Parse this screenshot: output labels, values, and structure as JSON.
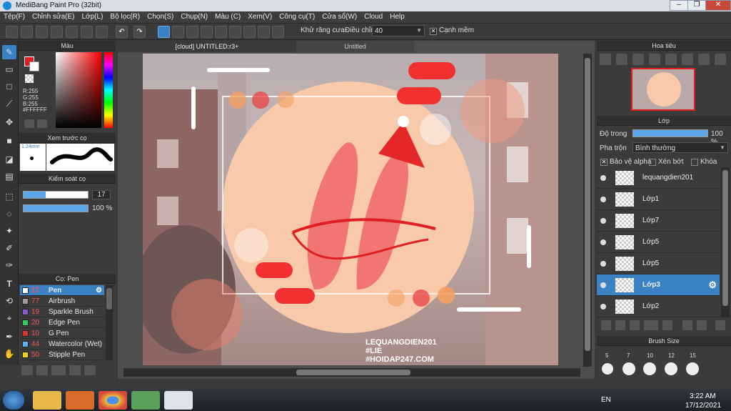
{
  "title": "MediBang Paint Pro (32bit)",
  "menu": [
    "Tệp(F)",
    "Chỉnh sửa(E)",
    "Lớp(L)",
    "Bộ lọc(R)",
    "Chọn(S)",
    "Chụp(N)",
    "Màu (C)",
    "Xem(V)",
    "Công cụ(T)",
    "Cửa sổ(W)",
    "Cloud",
    "Help"
  ],
  "toolbar": {
    "antialias": "Khử răng cưa",
    "adjust_label": "Điều chỉnh",
    "adjust_value": "40",
    "smooth": "Cạnh mềm"
  },
  "color_panel": {
    "title": "Màu",
    "r": "R:255",
    "g": "G:255",
    "b": "B:255",
    "hex": "#FFFFFF"
  },
  "preview_panel": {
    "title": "Xem trước cọ",
    "size": "1.24mm"
  },
  "brush_control": {
    "title": "Kiểm soát cọ",
    "size": "17",
    "opacity": "100 %"
  },
  "brush_panel": {
    "title": "Cọ: Pen",
    "items": [
      {
        "num": "17",
        "name": "Pen",
        "color": "#ffffff",
        "selected": true
      },
      {
        "num": "77",
        "name": "Airbrush",
        "color": "#9a9a9a",
        "selected": false
      },
      {
        "num": "19",
        "name": "Sparkle Brush",
        "color": "#8a5ad0",
        "selected": false
      },
      {
        "num": "20",
        "name": "Edge Pen",
        "color": "#33cc66",
        "selected": false
      },
      {
        "num": "10",
        "name": "G Pen",
        "color": "#e03030",
        "selected": false
      },
      {
        "num": "44",
        "name": "Watercolor (Wet)",
        "color": "#5ab0f0",
        "selected": false
      },
      {
        "num": "50",
        "name": "Stipple Pen",
        "color": "#f0d020",
        "selected": false
      }
    ]
  },
  "tabs": {
    "active": "[cloud] UNTITLED:r3+",
    "other": "Untitled"
  },
  "art_text": {
    "line1": "LEQUANGDIEN201",
    "line2": "#LIE",
    "line3": "#HOIDAP247.COM"
  },
  "navigator": {
    "title": "Hoa tiêu"
  },
  "layer_panel": {
    "title": "Lớp",
    "opacity_label": "Độ trong",
    "opacity_value": "100 %",
    "blend_label": "Pha trộn",
    "blend_value": "Bình thường",
    "protect_alpha": "Bảo vệ alpha",
    "clipping": "Xén bớt",
    "lock": "Khóa",
    "layers": [
      {
        "name": "lequangdien201",
        "selected": false
      },
      {
        "name": "Lớp1",
        "selected": false
      },
      {
        "name": "Lớp7",
        "selected": false
      },
      {
        "name": "Lớp5",
        "selected": false
      },
      {
        "name": "Lớp5",
        "selected": false
      },
      {
        "name": "Lớp3",
        "selected": true
      },
      {
        "name": "Lớp2",
        "selected": false
      }
    ]
  },
  "brush_size": {
    "title": "Brush Size",
    "sizes": [
      "5",
      "7",
      "10",
      "12",
      "15"
    ]
  },
  "taskbar": {
    "lang": "EN",
    "time": "3:22 AM",
    "date": "17/12/2021"
  }
}
